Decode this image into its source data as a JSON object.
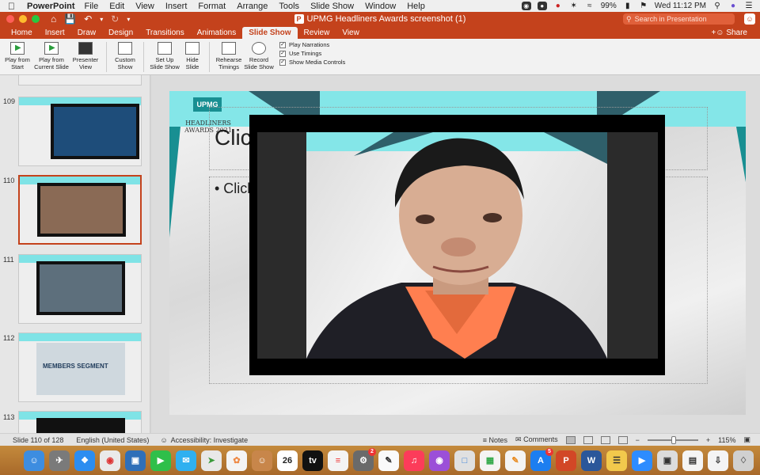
{
  "menubar": {
    "app_name": "PowerPoint",
    "items": [
      "File",
      "Edit",
      "View",
      "Insert",
      "Format",
      "Arrange",
      "Tools",
      "Slide Show",
      "Window",
      "Help"
    ],
    "battery": "99%",
    "clock": "Wed 11:12 PM"
  },
  "titlebar": {
    "title": "UPMG Headliners Awards screenshot (1)",
    "search_placeholder": "Search in Presentation"
  },
  "tabs": {
    "items": [
      "Home",
      "Insert",
      "Draw",
      "Design",
      "Transitions",
      "Animations",
      "Slide Show",
      "Review",
      "View"
    ],
    "active": "Slide Show",
    "share_label": "Share"
  },
  "ribbon": {
    "play_from_start": "Play from Start",
    "play_from_current": "Play from Current Slide",
    "presenter_view": "Presenter View",
    "custom_show": "Custom Show",
    "setup_show": "Set Up Slide Show",
    "hide_slide": "Hide Slide",
    "rehearse": "Rehearse Timings",
    "record": "Record Slide Show",
    "play_narrations": "Play Narrations",
    "use_timings": "Use Timings",
    "show_media_controls": "Show Media Controls"
  },
  "thumbnails": {
    "numbers": [
      "109",
      "110",
      "111",
      "112",
      "113"
    ],
    "members_segment": "MEMBERS SEGMENT"
  },
  "slide": {
    "logo": "UPMG",
    "logo_sub": "HEADLINERS AWARDS 2021",
    "title_placeholder": "Clic",
    "body_placeholder": "• Click"
  },
  "statusbar": {
    "slide_info": "Slide 110 of 128",
    "language": "English (United States)",
    "accessibility": "Accessibility: Investigate",
    "notes": "Notes",
    "comments": "Comments",
    "zoom": "115%"
  },
  "dock": {
    "calendar_day": "26",
    "badges": {
      "system_prefs": "2",
      "app_store": "5"
    }
  },
  "colors": {
    "accent": "#c4421c",
    "slide_cyan": "#84e6e8"
  }
}
